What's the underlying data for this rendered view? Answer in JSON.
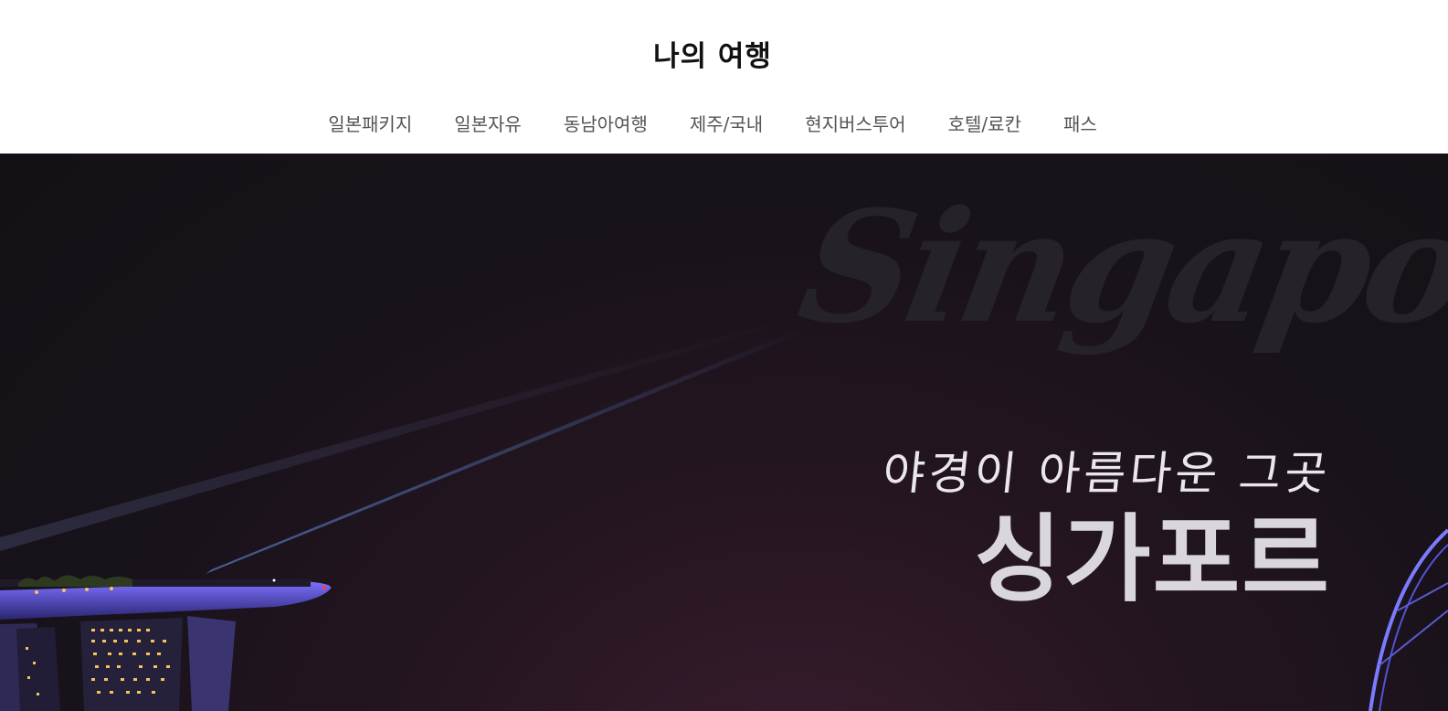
{
  "site": {
    "title": "나의 여행"
  },
  "nav": {
    "items": [
      {
        "label": "일본패키지",
        "id": "japan-package"
      },
      {
        "label": "일본자유",
        "id": "japan-free"
      },
      {
        "label": "동남아여행",
        "id": "southeast-asia"
      },
      {
        "label": "제주/국내",
        "id": "jeju-domestic"
      },
      {
        "label": "현지버스투어",
        "id": "local-bus-tour"
      },
      {
        "label": "호텔/료칸",
        "id": "hotel-ryokan"
      },
      {
        "label": "패스",
        "id": "pass"
      }
    ]
  },
  "hero": {
    "watermark": "Singapore",
    "subtitle": "야경이 아름다운 그곳",
    "headline": "싱가포르"
  },
  "colors": {
    "hero_bg": "#18121a",
    "accent_light": "#6d63ff",
    "building_light": "#f5c45a"
  }
}
